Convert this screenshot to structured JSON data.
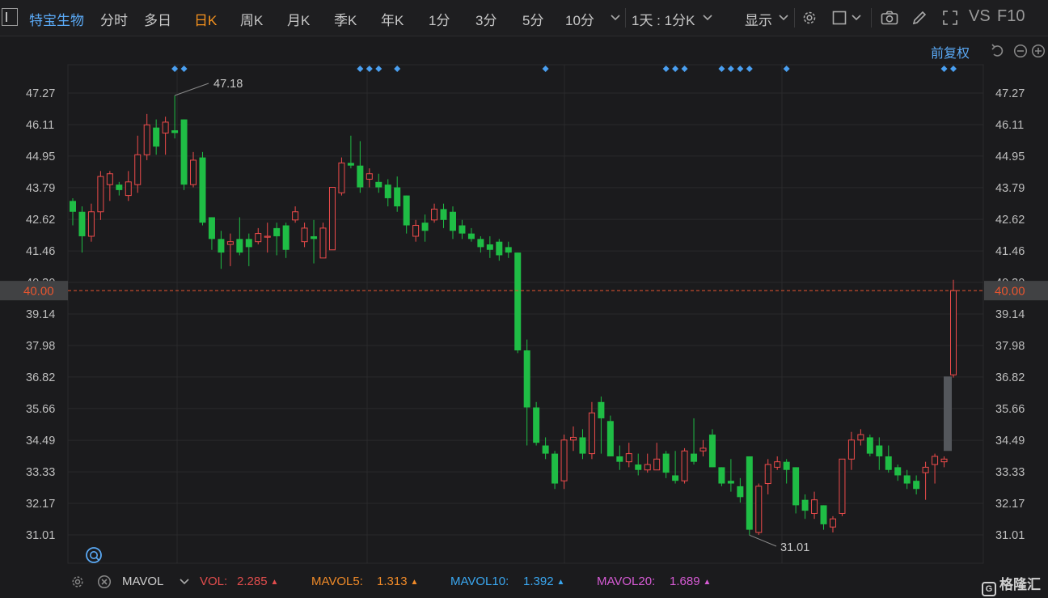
{
  "toolbar": {
    "stock_name": "特宝生物",
    "periods": [
      "分时",
      "多日",
      "日K",
      "周K",
      "月K",
      "季K",
      "年K",
      "1分",
      "3分",
      "5分",
      "10分"
    ],
    "active_period": "日K",
    "multi_period": "1天 : 1分K",
    "display_label": "显示",
    "vs_label": "VS",
    "f10_label": "F10"
  },
  "adjust_label": "前复权",
  "chart_data": {
    "type": "candlestick",
    "y_ticks": [
      47.27,
      46.11,
      44.95,
      43.79,
      42.62,
      41.46,
      40.3,
      39.14,
      37.98,
      36.82,
      35.66,
      34.49,
      33.33,
      32.17,
      31.01
    ],
    "current_price_label": "40.00",
    "current_price": 40.0,
    "max_label": "47.18",
    "min_label": "31.01",
    "colors": {
      "up": "#ee4b4b",
      "down": "#1fbd45",
      "price_line": "#e8552f",
      "axis_text": "#bfbfbf",
      "grid": "#2a2a2c",
      "event_marker": "#4a9ff0"
    },
    "candles": [
      [
        43.3,
        42.9,
        43.4,
        42.4
      ],
      [
        42.9,
        42.0,
        43.1,
        41.4
      ],
      [
        42.0,
        42.9,
        43.2,
        41.8
      ],
      [
        42.9,
        44.2,
        44.4,
        42.6
      ],
      [
        43.9,
        44.3,
        44.4,
        43.3
      ],
      [
        43.9,
        43.7,
        44.0,
        43.5
      ],
      [
        43.5,
        44.0,
        44.4,
        43.3
      ],
      [
        43.9,
        45.0,
        45.7,
        43.6
      ],
      [
        45.0,
        46.1,
        46.5,
        44.8
      ],
      [
        46.0,
        45.3,
        46.3,
        45.0
      ],
      [
        45.8,
        46.2,
        46.4,
        45.0
      ],
      [
        45.9,
        45.8,
        47.18,
        45.6
      ],
      [
        46.3,
        43.9,
        46.3,
        43.7
      ],
      [
        43.9,
        44.8,
        45.1,
        43.8
      ],
      [
        44.9,
        42.5,
        45.1,
        42.4
      ],
      [
        42.7,
        41.9,
        42.7,
        41.5
      ],
      [
        41.9,
        41.4,
        42.2,
        40.8
      ],
      [
        41.7,
        41.8,
        42.1,
        40.9
      ],
      [
        41.9,
        41.4,
        42.7,
        41.3
      ],
      [
        41.9,
        41.6,
        42.1,
        40.9
      ],
      [
        41.8,
        42.1,
        42.3,
        41.7
      ],
      [
        42.0,
        42.0,
        42.5,
        41.4
      ],
      [
        42.3,
        42.0,
        42.5,
        41.3
      ],
      [
        42.4,
        41.5,
        42.5,
        41.2
      ],
      [
        42.6,
        42.9,
        43.1,
        42.5
      ],
      [
        41.8,
        42.3,
        42.5,
        41.6
      ],
      [
        42.0,
        41.9,
        42.6,
        41.0
      ],
      [
        41.2,
        42.3,
        42.5,
        41.2
      ],
      [
        41.5,
        43.8,
        43.8,
        41.5
      ],
      [
        43.6,
        44.7,
        44.9,
        43.5
      ],
      [
        44.7,
        44.6,
        45.7,
        44.5
      ],
      [
        44.6,
        43.8,
        45.5,
        43.6
      ],
      [
        44.1,
        44.3,
        44.5,
        43.8
      ],
      [
        44.0,
        43.8,
        44.3,
        43.6
      ],
      [
        43.9,
        43.4,
        44.1,
        43.1
      ],
      [
        43.8,
        43.1,
        44.2,
        42.9
      ],
      [
        43.5,
        42.4,
        43.5,
        42.1
      ],
      [
        42.0,
        42.4,
        42.6,
        41.8
      ],
      [
        42.5,
        42.2,
        42.8,
        41.8
      ],
      [
        42.6,
        43.0,
        43.2,
        42.5
      ],
      [
        43.0,
        42.6,
        43.2,
        42.3
      ],
      [
        42.9,
        42.2,
        43.1,
        41.9
      ],
      [
        42.4,
        42.1,
        42.6,
        41.9
      ],
      [
        42.1,
        41.9,
        42.3,
        41.8
      ],
      [
        41.9,
        41.6,
        42.0,
        41.4
      ],
      [
        41.7,
        41.5,
        42.0,
        41.2
      ],
      [
        41.8,
        41.3,
        41.9,
        41.1
      ],
      [
        41.6,
        41.4,
        41.8,
        41.2
      ],
      [
        41.4,
        37.8,
        41.4,
        37.7
      ],
      [
        37.8,
        35.7,
        38.2,
        34.3
      ],
      [
        35.7,
        34.4,
        35.9,
        34.3
      ],
      [
        34.3,
        34.0,
        34.6,
        33.8
      ],
      [
        34.0,
        32.9,
        34.1,
        32.7
      ],
      [
        33.0,
        34.5,
        34.7,
        32.7
      ],
      [
        34.5,
        34.6,
        35.0,
        34.1
      ],
      [
        34.6,
        34.0,
        34.9,
        33.8
      ],
      [
        34.0,
        35.5,
        35.9,
        33.8
      ],
      [
        35.9,
        35.3,
        36.1,
        34.0
      ],
      [
        35.2,
        33.9,
        35.4,
        33.9
      ],
      [
        33.9,
        33.7,
        34.3,
        33.4
      ],
      [
        33.7,
        34.0,
        34.4,
        33.5
      ],
      [
        33.6,
        33.4,
        34.0,
        33.2
      ],
      [
        33.4,
        33.6,
        34.0,
        33.3
      ],
      [
        33.4,
        33.8,
        34.4,
        33.4
      ],
      [
        34.0,
        33.3,
        34.1,
        33.1
      ],
      [
        33.2,
        33.0,
        34.1,
        32.9
      ],
      [
        33.0,
        34.1,
        34.2,
        32.9
      ],
      [
        34.0,
        33.7,
        35.3,
        33.6
      ],
      [
        34.1,
        34.2,
        34.5,
        33.9
      ],
      [
        34.7,
        33.5,
        34.9,
        33.5
      ],
      [
        33.5,
        32.9,
        33.5,
        32.8
      ],
      [
        33.0,
        32.9,
        33.8,
        32.6
      ],
      [
        32.8,
        32.4,
        33.1,
        32.2
      ],
      [
        33.9,
        31.2,
        33.9,
        31.0
      ],
      [
        31.1,
        32.8,
        32.9,
        31.01
      ],
      [
        32.9,
        33.6,
        33.8,
        32.5
      ],
      [
        33.5,
        33.7,
        33.9,
        33.4
      ],
      [
        33.7,
        33.4,
        33.8,
        32.9
      ],
      [
        33.5,
        32.1,
        33.5,
        31.8
      ],
      [
        32.3,
        31.9,
        32.5,
        31.6
      ],
      [
        31.8,
        32.3,
        32.6,
        31.6
      ],
      [
        32.1,
        31.4,
        32.1,
        31.2
      ],
      [
        31.3,
        31.6,
        31.7,
        31.1
      ],
      [
        31.8,
        33.8,
        33.8,
        31.7
      ],
      [
        33.8,
        34.5,
        34.8,
        33.4
      ],
      [
        34.5,
        34.7,
        34.9,
        34.3
      ],
      [
        34.6,
        34.0,
        34.7,
        33.9
      ],
      [
        34.3,
        33.9,
        34.6,
        33.4
      ],
      [
        33.9,
        33.4,
        34.3,
        33.3
      ],
      [
        33.5,
        33.2,
        33.6,
        33.0
      ],
      [
        33.2,
        32.9,
        33.4,
        32.7
      ],
      [
        33.0,
        32.7,
        33.2,
        32.5
      ],
      [
        33.3,
        33.5,
        33.7,
        32.3
      ],
      [
        33.6,
        33.9,
        34.0,
        32.9
      ],
      [
        33.7,
        33.8,
        33.9,
        33.5
      ],
      [
        36.9,
        40.0,
        40.4,
        36.8
      ]
    ],
    "ghost_bar": {
      "top": 36.84,
      "bottom": 34.1,
      "color": "#54575c"
    },
    "event_markers": [
      11,
      12,
      31,
      32,
      33,
      35,
      51,
      64,
      65,
      66,
      70,
      71,
      72,
      73,
      77,
      94,
      95
    ]
  },
  "indicator": {
    "name": "MAVOL",
    "items": [
      {
        "label": "VOL:",
        "value": "2.285",
        "color": "#e24d4d"
      },
      {
        "label": "MAVOL5:",
        "value": "1.313",
        "color": "#f08a28"
      },
      {
        "label": "MAVOL10:",
        "value": "1.392",
        "color": "#3aa7f0"
      },
      {
        "label": "MAVOL20:",
        "value": "1.689",
        "color": "#d65bd4"
      }
    ]
  },
  "brand": "格隆汇",
  "icons": {
    "menu": "menu-icon",
    "settings": "gear-icon",
    "checkbox": "square-icon",
    "camera": "camera-icon",
    "pen": "pen-icon",
    "fullscreen": "expand-icon",
    "undo": "undo-icon",
    "minus": "minus-circle-icon",
    "plus": "plus-circle-icon",
    "zoom": "zoom-icon",
    "close": "close-circle-icon"
  }
}
